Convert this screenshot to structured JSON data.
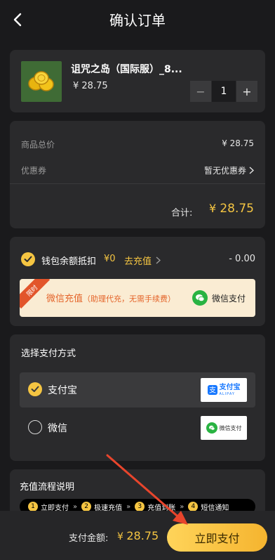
{
  "header": {
    "title": "确认订单"
  },
  "product": {
    "name": "诅咒之岛（国际服）_8...",
    "price": "¥ 28.75",
    "quantity": "1",
    "minus_label": "−",
    "plus_label": "+"
  },
  "summary": {
    "total_label": "商品总价",
    "total_value": "¥ 28.75",
    "coupon_label": "优惠券",
    "coupon_value": "暂无优惠券",
    "subtotal_label": "合计:",
    "subtotal_currency": "¥",
    "subtotal_value": "28.75"
  },
  "wallet": {
    "label": "钱包余额抵扣",
    "amount": "¥0",
    "recharge_link": "去充值",
    "deduction": "- 0.00",
    "banner_tag": "限时",
    "banner_text": "微信充值",
    "banner_sub": "（助理代充，无需手续费）",
    "banner_pay": "微信支付"
  },
  "payment": {
    "title": "选择支付方式",
    "options": [
      {
        "name": "支付宝",
        "logo_cn": "支付宝",
        "logo_en": "ALIPAY",
        "selected": true
      },
      {
        "name": "微信",
        "logo_text": "微信支付",
        "selected": false
      }
    ]
  },
  "flow": {
    "title": "充值流程说明",
    "steps": [
      {
        "num": "1",
        "label": "立即支付"
      },
      {
        "num": "2",
        "label": "极速充值"
      },
      {
        "num": "3",
        "label": "充值到账"
      },
      {
        "num": "4",
        "label": "短信通知"
      }
    ]
  },
  "footer": {
    "amount_label": "支付金额:",
    "currency": "¥",
    "amount": "28.75",
    "pay_button": "立即支付"
  },
  "colors": {
    "accent": "#f5c542",
    "background": "#1a1a1c",
    "card": "#2a2a2c",
    "wechat": "#29b342",
    "alipay": "#1677ff",
    "annotation_arrow": "#e8452c"
  }
}
